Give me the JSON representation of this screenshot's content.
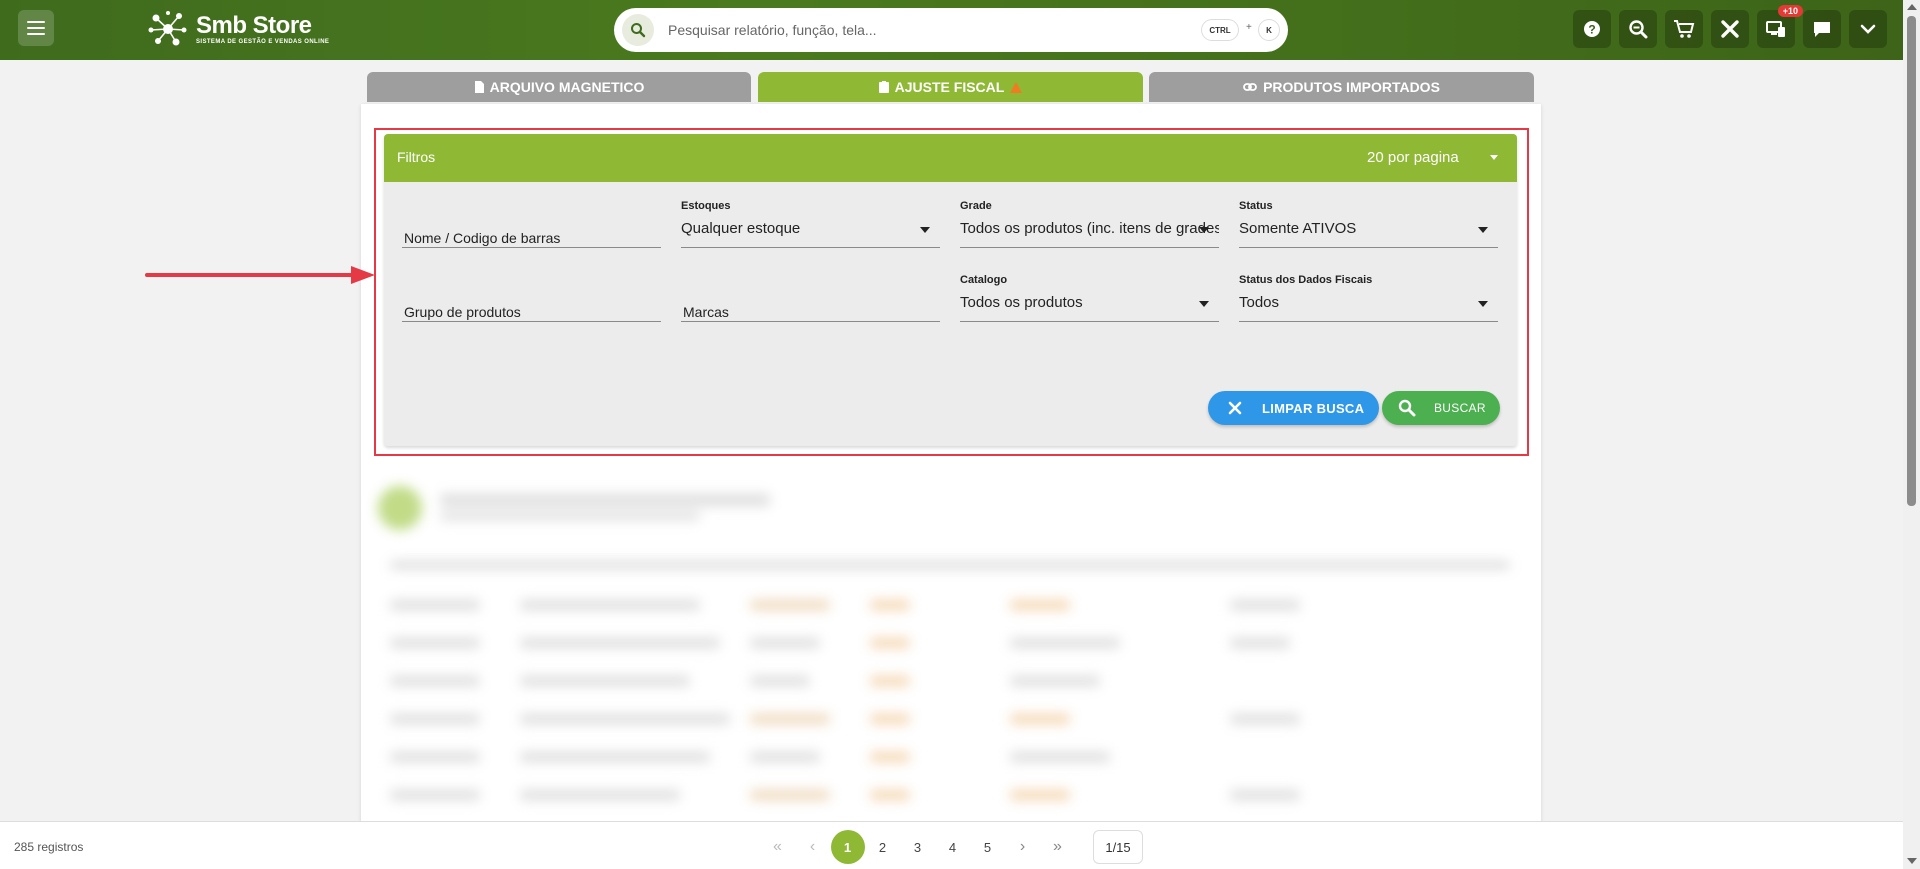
{
  "header": {
    "brand_name": "Smb Store",
    "brand_subtitle": "SISTEMA DE GESTÃO E VENDAS ONLINE",
    "search_placeholder": "Pesquisar relatório, função, tela...",
    "shortcut_ctrl": "CTRL",
    "shortcut_plus": "+",
    "shortcut_key": "K",
    "notifications_badge": "+10",
    "icons": [
      "help-icon",
      "zoom-search-icon",
      "cart-icon",
      "tools-icon",
      "devices-icon",
      "chat-icon",
      "chevron-down-icon"
    ]
  },
  "tabs": [
    {
      "label": "ARQUIVO MAGNETICO",
      "active": false
    },
    {
      "label": "AJUSTE FISCAL",
      "active": true
    },
    {
      "label": "PRODUTOS IMPORTADOS",
      "active": false
    }
  ],
  "filters": {
    "title": "Filtros",
    "per_page": "20 por pagina",
    "name_placeholder": "Nome / Codigo de barras",
    "stock_label": "Estoques",
    "stock_value": "Qualquer estoque",
    "grade_label": "Grade",
    "grade_value": "Todos os produtos (inc. itens de grades)",
    "status_label": "Status",
    "status_value": "Somente ATIVOS",
    "group_placeholder": "Grupo de produtos",
    "brands_placeholder": "Marcas",
    "catalog_label": "Catalogo",
    "catalog_value": "Todos os produtos",
    "fiscal_label": "Status dos Dados Fiscais",
    "fiscal_value": "Todos",
    "clear_button": "LIMPAR BUSCA",
    "search_button": "BUSCAR"
  },
  "footer": {
    "records": "285 registros",
    "pages": [
      "1",
      "2",
      "3",
      "4",
      "5"
    ],
    "current_page": "1",
    "page_indicator": "1/15"
  },
  "colors": {
    "brand_green": "#4a7a1e",
    "accent_green": "#8fb935",
    "highlight_red": "#e53946",
    "clear_blue": "#2e97e8",
    "search_green": "#4caf50"
  }
}
